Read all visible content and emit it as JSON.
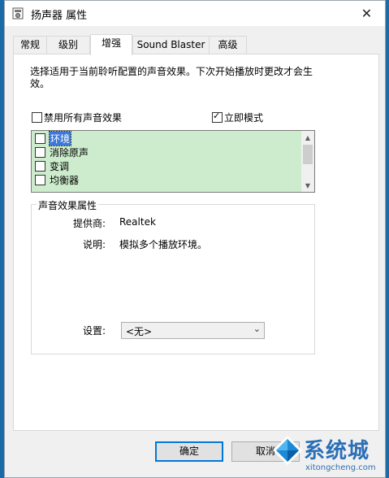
{
  "window": {
    "title": "扬声器 属性",
    "close_glyph": "✕"
  },
  "tabs": [
    {
      "label": "常规"
    },
    {
      "label": "级别"
    },
    {
      "label": "增强"
    },
    {
      "label": "Sound Blaster"
    },
    {
      "label": "高级"
    }
  ],
  "active_tab": "增强",
  "description": "选择适用于当前聆听配置的声音效果。下次开始播放时更改才会生效。",
  "options": {
    "disable_all": {
      "label": "禁用所有声音效果",
      "checked": false
    },
    "immediate_mode": {
      "label": "立即模式",
      "checked": true
    }
  },
  "effects_list": {
    "items": [
      {
        "label": "环境",
        "checked": false,
        "selected": true
      },
      {
        "label": "消除原声",
        "checked": false,
        "selected": false
      },
      {
        "label": "变调",
        "checked": false,
        "selected": false
      },
      {
        "label": "均衡器",
        "checked": false,
        "selected": false
      }
    ],
    "background_color": "#cdeccd"
  },
  "properties": {
    "group_title": "声音效果属性",
    "provider_label": "提供商:",
    "provider_value": "Realtek",
    "description_label": "说明:",
    "description_value": "模拟多个播放环境。",
    "settings_label": "设置:",
    "settings_value": "<无>"
  },
  "buttons": {
    "ok": "确定",
    "cancel": "取消"
  },
  "watermark": {
    "text": "系统城",
    "url": "xitongcheng.com"
  },
  "colors": {
    "desktop": "#0f5a96",
    "selection": "#3c78d8",
    "accent": "#0078d7"
  },
  "icons": {
    "title": "speaker-properties-icon",
    "close": "close-icon",
    "scroll_up": "chevron-up-icon",
    "scroll_down": "chevron-down-icon",
    "dropdown": "chevron-down-icon"
  }
}
